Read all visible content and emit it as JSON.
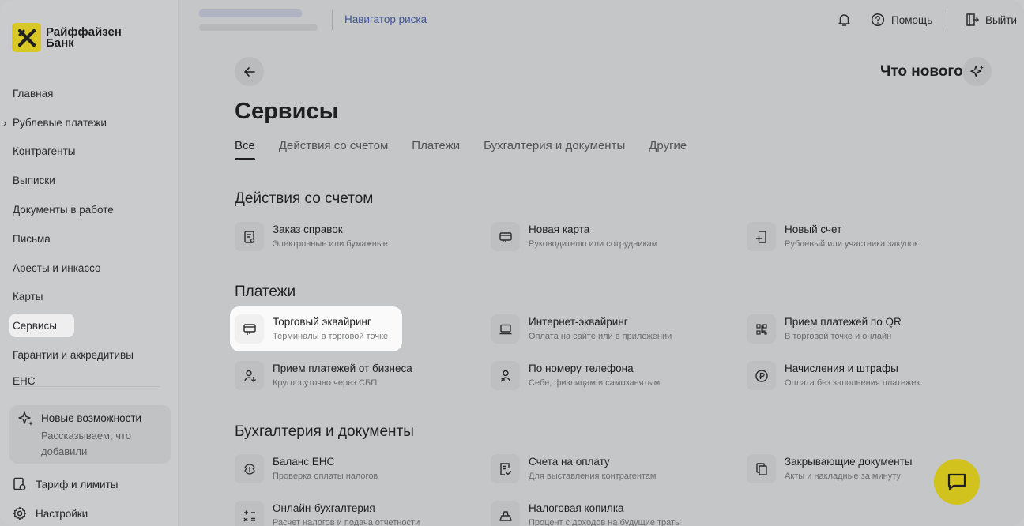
{
  "brand": {
    "name_line1": "Райффайзен",
    "name_line2": "Банк",
    "accent": "#fee600"
  },
  "sidebar": {
    "items": [
      {
        "label": "Главная"
      },
      {
        "label": "Рублевые платежи",
        "expandable": true
      },
      {
        "label": "Контрагенты"
      },
      {
        "label": "Выписки"
      },
      {
        "label": "Документы в работе"
      },
      {
        "label": "Письма"
      },
      {
        "label": "Аресты и инкассо"
      },
      {
        "label": "Карты"
      },
      {
        "label": "Сервисы",
        "active": true
      },
      {
        "label": "Гарантии и аккредитивы"
      },
      {
        "label": "ЕНС"
      }
    ],
    "promo": {
      "title": "Новые возможности",
      "text": "Рассказываем, что добавили"
    },
    "tariff": "Тариф и лимиты",
    "settings": "Настройки"
  },
  "topbar": {
    "nav_risk": "Навигатор риска",
    "help": "Помощь",
    "logout": "Выйти"
  },
  "main": {
    "whats_new": "Что нового",
    "title": "Сервисы",
    "tabs": [
      "Все",
      "Действия со счетом",
      "Платежи",
      "Бухгалтерия и документы",
      "Другие"
    ],
    "active_tab": "Все",
    "sections": [
      {
        "title": "Действия со счетом",
        "cards": [
          {
            "title": "Заказ справок",
            "subtitle": "Электронные или бумажные",
            "icon": "document-icon"
          },
          {
            "title": "Новая карта",
            "subtitle": "Руководителю или сотрудникам",
            "icon": "card-icon"
          },
          {
            "title": "Новый счет",
            "subtitle": "Рублевый или участника закупок",
            "icon": "add-account-icon"
          }
        ]
      },
      {
        "title": "Платежи",
        "cards": [
          {
            "title": "Торговый эквайринг",
            "subtitle": "Терминалы в торговой точке",
            "icon": "terminal-icon",
            "highlighted": true
          },
          {
            "title": "Интернет-эквайринг",
            "subtitle": "Оплата на сайте или в приложении",
            "icon": "laptop-icon"
          },
          {
            "title": "Прием платежей по QR",
            "subtitle": "В торговой точке и онлайн",
            "icon": "qr-icon"
          },
          {
            "title": "Прием платежей от бизнеса",
            "subtitle": "Круглосуточно через СБП",
            "icon": "person-in-icon"
          },
          {
            "title": "По номеру телефона",
            "subtitle": "Себе, физлицам и самозанятым",
            "icon": "person-out-icon"
          },
          {
            "title": "Начисления и штрафы",
            "subtitle": "Оплата без заполнения платежек",
            "icon": "ruble-icon"
          }
        ]
      },
      {
        "title": "Бухгалтерия и документы",
        "cards": [
          {
            "title": "Баланс ЕНС",
            "subtitle": "Проверка оплаты налогов",
            "icon": "emblem-icon"
          },
          {
            "title": "Счета на оплату",
            "subtitle": "Для выставления контрагентам",
            "icon": "invoice-icon"
          },
          {
            "title": "Закрывающие документы",
            "subtitle": "Акты и накладные за минуту",
            "icon": "copy-doc-icon"
          },
          {
            "title": "Онлайн-бухгалтерия",
            "subtitle": "Расчет налогов и подача отчетности",
            "icon": "calculator-icon"
          },
          {
            "title": "Налоговая копилка",
            "subtitle": "Процент с доходов на будущие траты",
            "icon": "piggy-icon"
          }
        ]
      }
    ]
  }
}
